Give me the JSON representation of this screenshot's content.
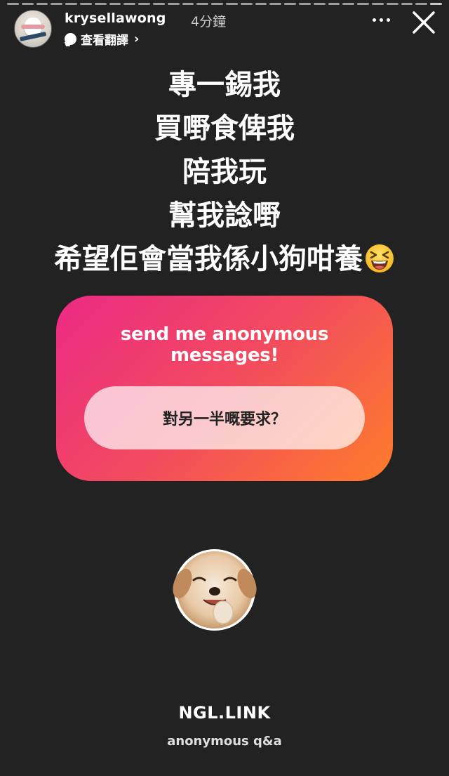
{
  "story": {
    "segment_count": 30,
    "active_segment": 29
  },
  "header": {
    "username": "krysellawong",
    "time_ago": "4分鐘",
    "translate_label": "查看翻譯",
    "more_icon": "more-horizontal-icon",
    "close_icon": "close-icon"
  },
  "caption": {
    "lines": [
      "專一錫我",
      "買嘢食俾我",
      "陪我玩",
      "幫我諗嘢",
      "希望佢會當我係小狗咁養"
    ],
    "emoji": "laughing-squinting-face-emoji"
  },
  "ngl_card": {
    "title_line1": "send me anonymous",
    "title_line2": "messages!",
    "question": "對另一半嘅要求？",
    "gradient": [
      "#ec2a84",
      "#f24b5e",
      "#fe7d2a"
    ]
  },
  "sticker": {
    "name": "puppy-sticker"
  },
  "brand": {
    "name": "NGL.LINK",
    "tagline": "anonymous q&a"
  },
  "colors": {
    "background": "#222222",
    "text": "#ffffff"
  }
}
